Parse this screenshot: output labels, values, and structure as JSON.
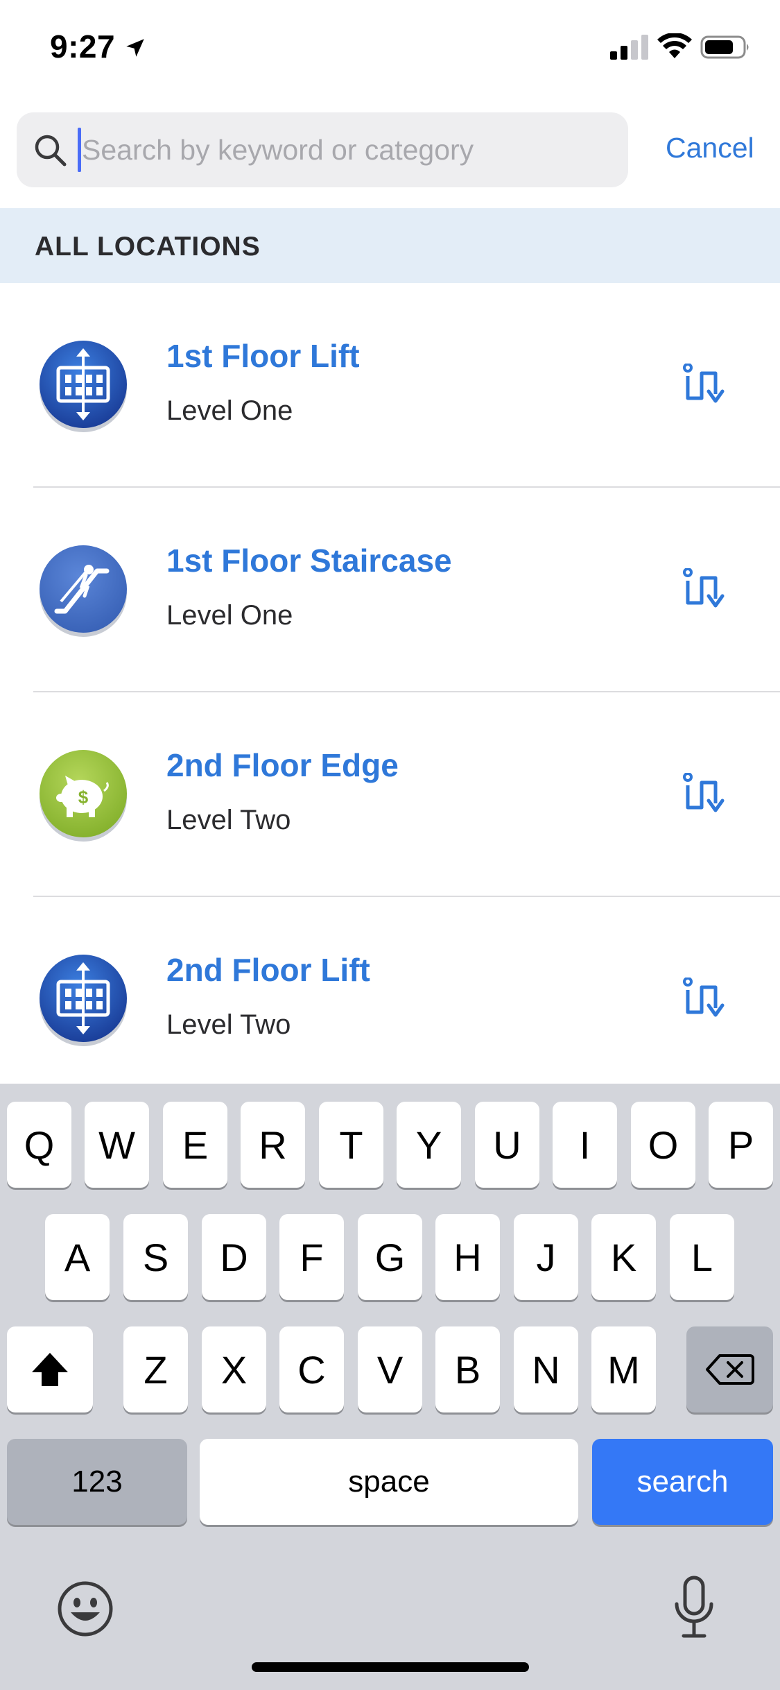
{
  "status_bar": {
    "time": "9:27"
  },
  "search": {
    "placeholder": "Search by keyword or category",
    "value": "",
    "cancel_label": "Cancel"
  },
  "section": {
    "title": "ALL LOCATIONS"
  },
  "locations": [
    {
      "title": "1st Floor Lift",
      "subtitle": "Level One",
      "icon": "elevator-icon"
    },
    {
      "title": "1st Floor Staircase",
      "subtitle": "Level One",
      "icon": "escalator-icon"
    },
    {
      "title": "2nd Floor Edge",
      "subtitle": "Level Two",
      "icon": "piggy-bank-icon"
    },
    {
      "title": "2nd Floor Lift",
      "subtitle": "Level Two",
      "icon": "elevator-icon"
    }
  ],
  "keyboard": {
    "row1": [
      "Q",
      "W",
      "E",
      "R",
      "T",
      "Y",
      "U",
      "I",
      "O",
      "P"
    ],
    "row2": [
      "A",
      "S",
      "D",
      "F",
      "G",
      "H",
      "J",
      "K",
      "L"
    ],
    "row3": [
      "Z",
      "X",
      "C",
      "V",
      "B",
      "N",
      "M"
    ],
    "numbers_label": "123",
    "space_label": "space",
    "search_label": "search"
  },
  "colors": {
    "accent": "#2f78d9",
    "section_bg": "#e3edf7",
    "keyboard_bg": "#d3d5db",
    "search_key": "#3478f6"
  }
}
